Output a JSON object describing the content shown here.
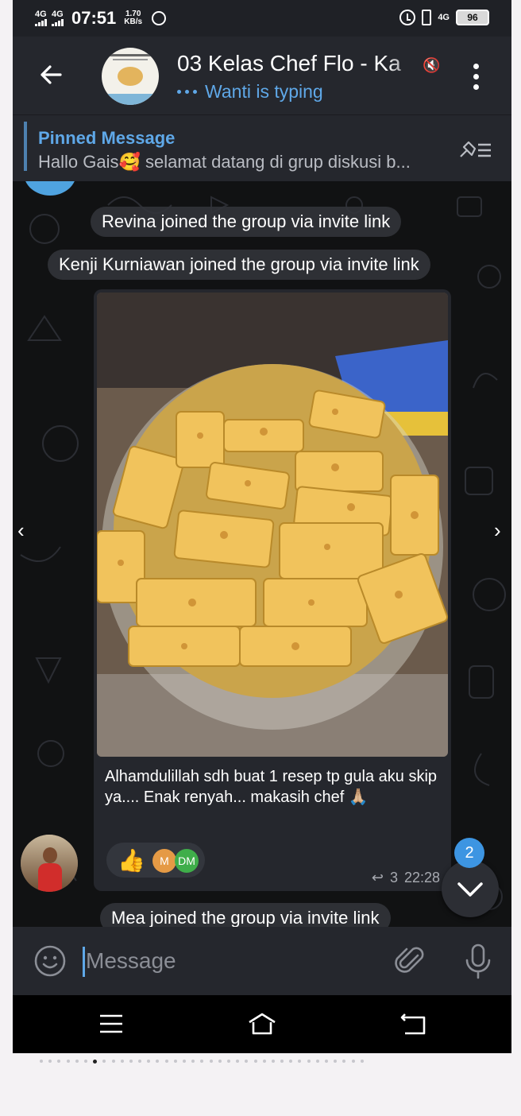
{
  "status_bar": {
    "network1": "4G",
    "network2": "4G",
    "time": "07:51",
    "speed_value": "1.70",
    "speed_unit": "KB/s",
    "network3": "4G",
    "battery": "96"
  },
  "header": {
    "title": "03 Kelas Chef Flo - Ka",
    "typing_status": "Wanti is typing"
  },
  "pinned": {
    "title": "Pinned Message",
    "text": "Hallo Gais🥰 selamat datang di grup diskusi b..."
  },
  "chat": {
    "system_messages": [
      "Revina joined the group via invite link",
      "Kenji Kurniawan joined the group via invite link",
      "Mea joined the group via invite link"
    ],
    "message": {
      "caption": "Alhamdulillah sdh buat 1 resep tp gula aku skip ya.... Enak renyah... makasih chef 🙏🏼",
      "reaction_emoji": "👍",
      "reactor_initials": [
        "M",
        "DM"
      ],
      "reply_count": "3",
      "time": "22:28"
    },
    "unread_count": "2"
  },
  "input": {
    "placeholder": "Message"
  },
  "colors": {
    "accent": "#5fa8e8",
    "header_bg": "#25272d",
    "chat_bg": "#111213",
    "unread_badge": "#3d95e2"
  },
  "icons": [
    "back-arrow-icon",
    "mute-icon",
    "more-vert-icon",
    "unpin-list-icon",
    "emoji-icon",
    "attach-icon",
    "mic-icon",
    "chevron-down-icon",
    "menu-icon",
    "home-icon",
    "back-nav-icon"
  ]
}
